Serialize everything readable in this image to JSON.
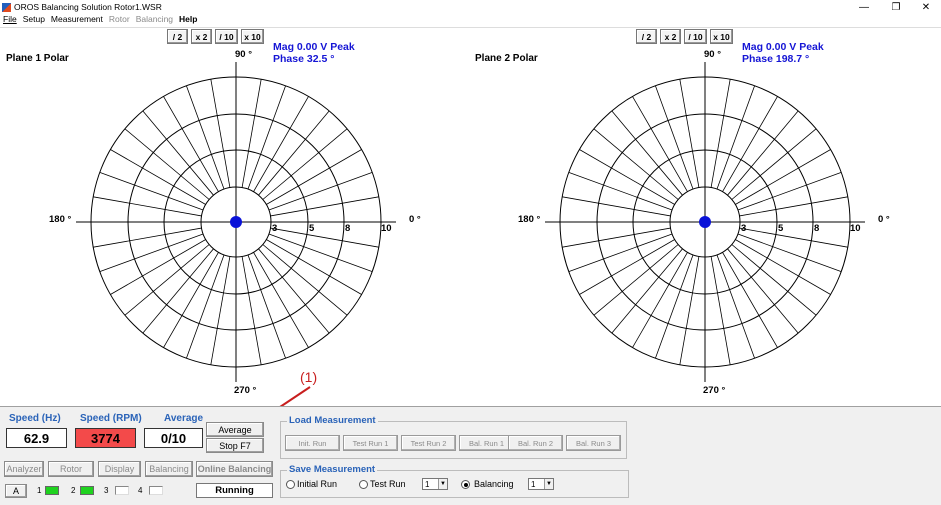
{
  "window": {
    "title": "OROS Balancing Solution Rotor1.WSR",
    "controls": {
      "minimize": "—",
      "restore": "❐",
      "close": "✕"
    }
  },
  "menu": [
    {
      "label": "File",
      "enabled": true
    },
    {
      "label": "Setup",
      "enabled": true
    },
    {
      "label": "Measurement",
      "enabled": true
    },
    {
      "label": "Rotor",
      "enabled": false
    },
    {
      "label": "Balancing",
      "enabled": false
    },
    {
      "label": "Help",
      "enabled": true
    }
  ],
  "zoom_buttons": [
    "/ 2",
    "x 2",
    "/ 10",
    "x 10"
  ],
  "plane1": {
    "title": "Plane 1  Polar",
    "mag": "Mag    0.00 V Peak",
    "phase": "Phase 32.5 °",
    "deg_90": "90 °",
    "deg_0": "0 °",
    "deg_180": "180 °",
    "deg_270": "270 °",
    "rings": [
      "3",
      "5",
      "8",
      "10"
    ]
  },
  "plane2": {
    "title": "Plane 2  Polar",
    "mag": "Mag    0.00 V Peak",
    "phase": "Phase 198.7 °",
    "deg_90": "90 °",
    "deg_0": "0 °",
    "deg_180": "180 °",
    "deg_270": "270 °",
    "rings": [
      "3",
      "5",
      "8",
      "10"
    ]
  },
  "annotation": "(1)",
  "colors": {
    "accent_blue": "#1515d5",
    "label_blue": "#2a63b8",
    "rpm_red": "#f34a4a",
    "led_green": "#1fd21f",
    "arrow_red": "#c81e1e"
  },
  "status": {
    "speed_hz_label": "Speed (Hz)",
    "speed_hz_value": "62.9",
    "speed_rpm_label": "Speed (RPM)",
    "speed_rpm_value": "3774",
    "average_label": "Average",
    "average_value": "0/10",
    "average_button": "Average",
    "stop_button": "Stop  F7",
    "running": "Running"
  },
  "tabs": {
    "analyzer": "Analyzer",
    "rotor": "Rotor",
    "display": "Display",
    "balancing": "Balancing",
    "online_balancing": "Online Balancing"
  },
  "channels": {
    "a_button": "A",
    "items": [
      {
        "num": "1",
        "state": "green"
      },
      {
        "num": "2",
        "state": "green"
      },
      {
        "num": "3",
        "state": "white"
      },
      {
        "num": "4",
        "state": "white"
      }
    ]
  },
  "load_measurement": {
    "title": "Load Measurement",
    "buttons": [
      "Init. Run",
      "Test Run 1",
      "Test Run 2",
      "Bal. Run 1",
      "Bal. Run 2",
      "Bal. Run 3"
    ]
  },
  "save_measurement": {
    "title": "Save Measurement",
    "initial_run": "Initial Run",
    "test_run": "Test Run",
    "test_run_value": "1",
    "balancing": "Balancing",
    "balancing_value": "1",
    "selected": "balancing"
  }
}
